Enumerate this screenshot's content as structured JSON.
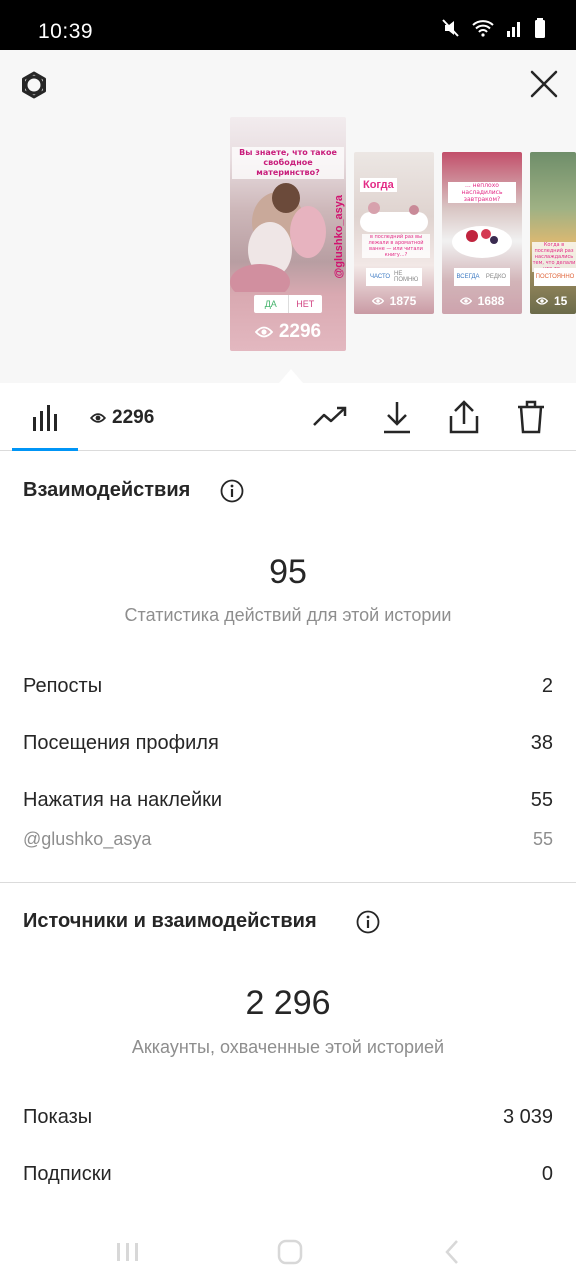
{
  "status_bar": {
    "time": "10:39",
    "icons": [
      "mute-icon",
      "wifi-icon",
      "signal-icon",
      "battery-icon"
    ]
  },
  "header": {
    "settings_icon": "gear-icon",
    "close_icon": "close-icon"
  },
  "stories": [
    {
      "question": "Вы знаете, что такое свободное материнство?",
      "handle": "@glushko_asya",
      "poll_yes": "ДА",
      "poll_no": "НЕТ",
      "views": "2296",
      "selected": true
    },
    {
      "title": "Когда",
      "note": "в последний раз вы лежали в ароматной ванне — или читали книгу...?",
      "poll_a": "ЧАСТО",
      "poll_b": "НЕ ПОМНЮ",
      "views": "1875"
    },
    {
      "note": "... неплохо насладились завтраком?",
      "poll_a": "ВСЕГДА",
      "poll_b": "РЕДКО",
      "views": "1688"
    },
    {
      "note": "Когда в последний раз наслаждались тем, что делали что-то...",
      "poll_a": "ПОСТОЯННО",
      "views": "15"
    }
  ],
  "toolbar": {
    "insights_icon": "bar-chart-icon",
    "viewers_count": "2296",
    "actions": [
      "trending-icon",
      "download-icon",
      "share-icon",
      "trash-icon"
    ]
  },
  "interactions": {
    "title": "Взаимодействия",
    "total": "95",
    "subtitle": "Статистика действий для этой истории",
    "rows": [
      {
        "label": "Репосты",
        "value": "2"
      },
      {
        "label": "Посещения профиля",
        "value": "38"
      },
      {
        "label": "Нажатия на наклейки",
        "value": "55"
      }
    ],
    "sticker_row": {
      "label": "@glushko_asya",
      "value": "55"
    }
  },
  "discovery": {
    "title": "Источники и взаимодействия",
    "total": "2 296",
    "subtitle": "Аккаунты, охваченные этой историей",
    "rows": [
      {
        "label": "Показы",
        "value": "3 039"
      },
      {
        "label": "Подписки",
        "value": "0"
      }
    ]
  },
  "nav_bar": {
    "icons": [
      "recent-apps-icon",
      "home-icon",
      "back-icon"
    ]
  },
  "colors": {
    "accent": "#0095f6",
    "text": "#262626",
    "muted": "#8e8e8e",
    "divider": "#dbdbdb"
  }
}
